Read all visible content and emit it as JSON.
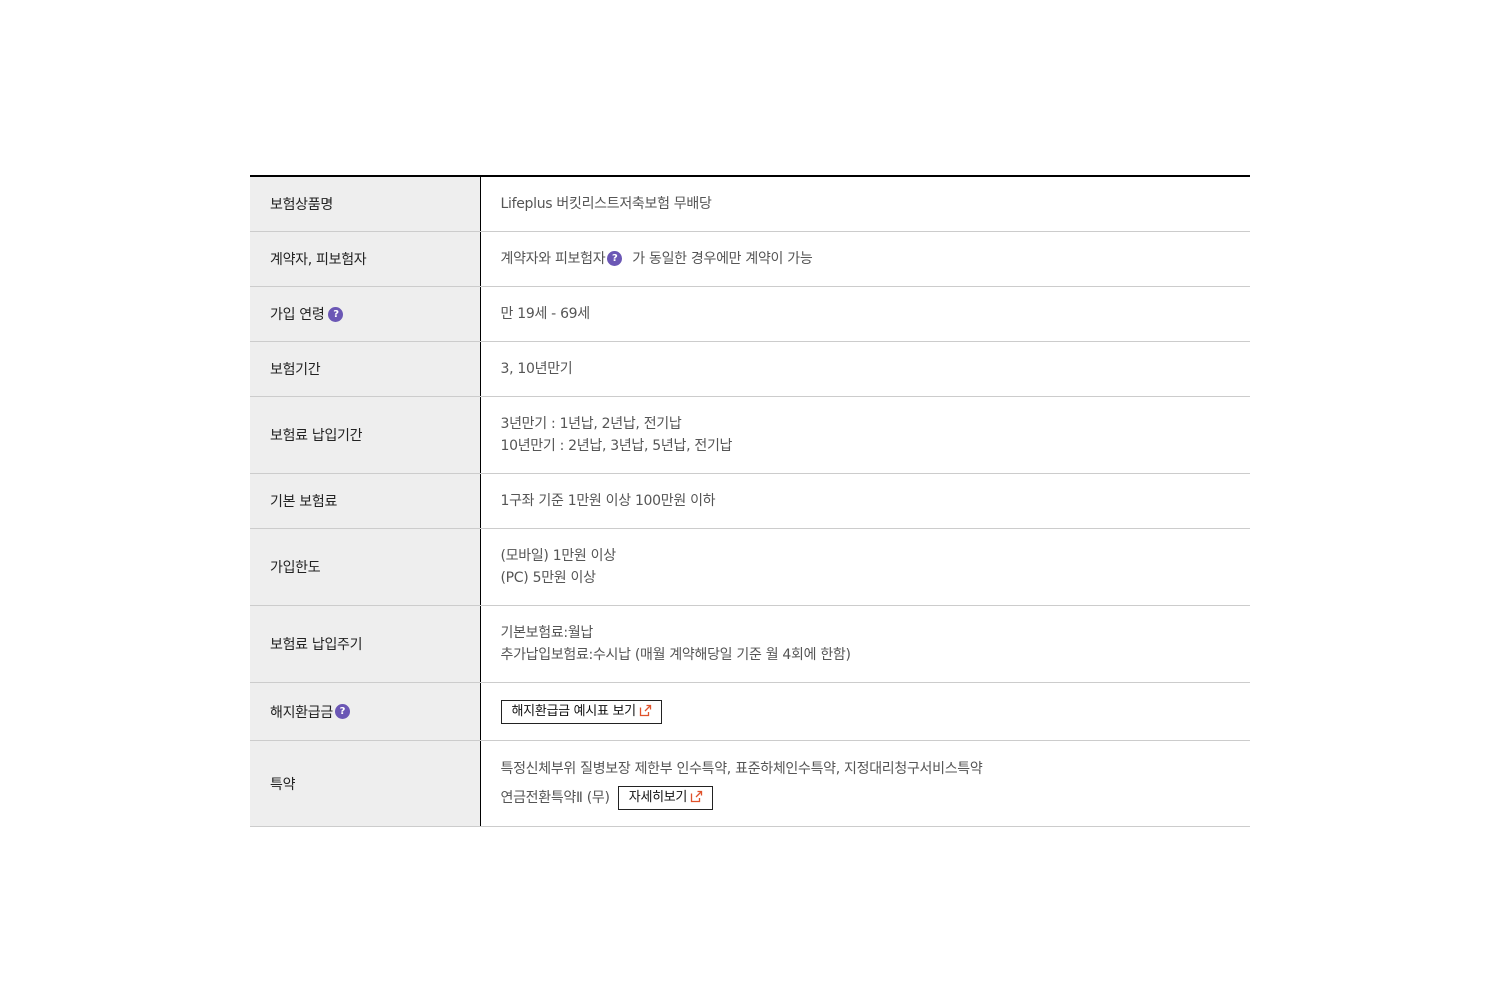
{
  "rows": {
    "product_name": {
      "label": "보험상품명",
      "value": "Lifeplus 버킷리스트저축보험 무배당"
    },
    "parties": {
      "label": "계약자, 피보험자",
      "value_before": "계약자와 피보험자",
      "value_after": "가 동일한 경우에만 계약이 가능",
      "help_icon": "question-icon"
    },
    "age": {
      "label": "가입 연령",
      "value": "만 19세 - 69세",
      "help_icon": "question-icon"
    },
    "term": {
      "label": "보험기간",
      "value": "3, 10년만기"
    },
    "payment_period": {
      "label": "보험료 납입기간",
      "lines": [
        "3년만기 : 1년납, 2년납, 전기납",
        "10년만기 : 2년납, 3년납, 5년납, 전기납"
      ]
    },
    "base_premium": {
      "label": "기본 보험료",
      "value": "1구좌 기준 1만원 이상 100만원 이하"
    },
    "limit": {
      "label": "가입한도",
      "lines": [
        "(모바일) 1만원 이상",
        "(PC) 5만원 이상"
      ]
    },
    "payment_cycle": {
      "label": "보험료 납입주기",
      "lines": [
        "기본보험료:월납",
        "추가납입보험료:수시납 (매월 계약해당일 기준 월 4회에 한함)"
      ]
    },
    "surrender": {
      "label": "해지환급금",
      "button_label": "해지환급금 예시표 보기",
      "help_icon": "question-icon",
      "link_icon": "external-link-icon"
    },
    "riders": {
      "label": "특약",
      "line1": "특정신체부위 질병보장 제한부 인수특약, 표준하체인수특약, 지정대리청구서비스특약",
      "line2": "연금전환특약Ⅱ (무)",
      "button_label": "자세히보기",
      "link_icon": "external-link-icon"
    }
  },
  "help_glyph": "?",
  "colors": {
    "help_icon": "#6b57b5",
    "link_icon": "#e0522b",
    "header_bg": "#eeeeee"
  }
}
